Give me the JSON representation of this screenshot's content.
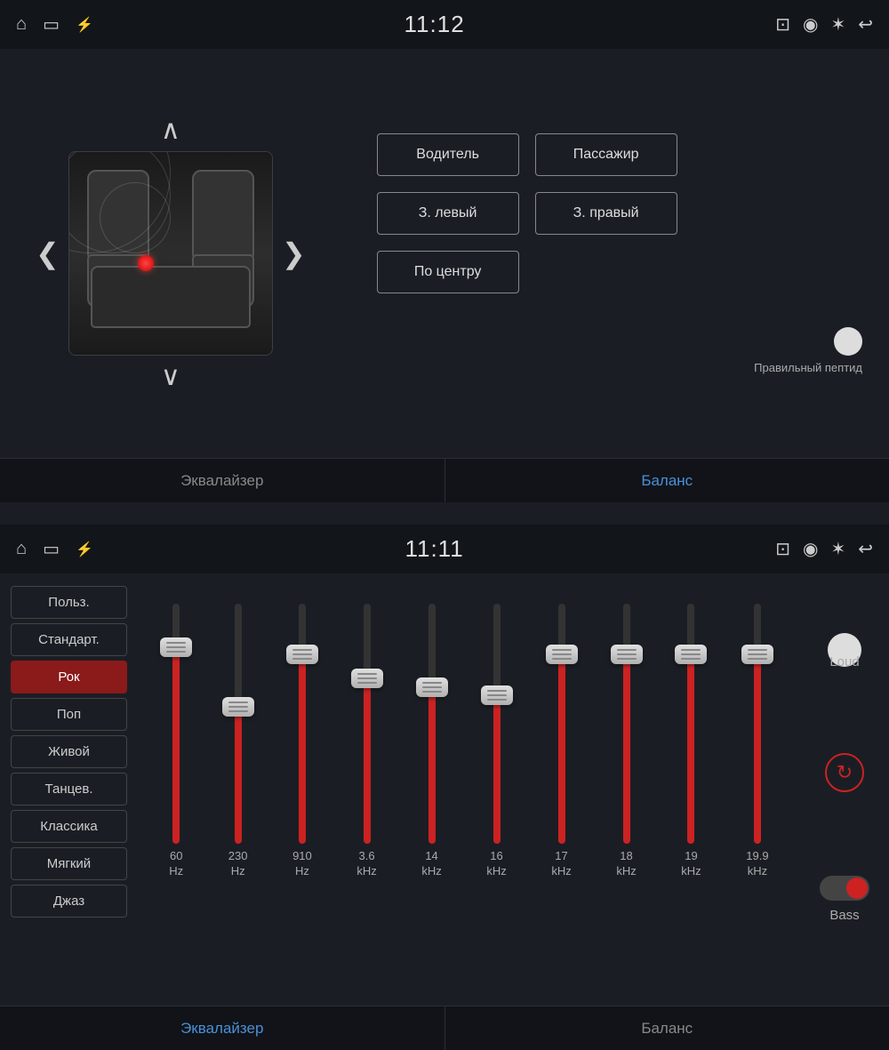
{
  "topPanel": {
    "statusBar": {
      "time": "11:12",
      "icons": {
        "home": "⌂",
        "screen": "▭",
        "usb": "⚡",
        "cast": "⊡",
        "location": "◉",
        "bluetooth": "✶",
        "back": "↩"
      }
    },
    "upArrow": "∧",
    "downArrow": "∨",
    "leftArrow": "❮",
    "rightArrow": "❯",
    "speakerButtons": {
      "driver": "Водитель",
      "passenger": "Пассажир",
      "rearLeft": "З. левый",
      "rearRight": "З. правый",
      "center": "По центру"
    },
    "toggleLabel": "Правильный пептид",
    "tabs": {
      "equalizer": "Эквалайзер",
      "balance": "Баланс"
    }
  },
  "bottomPanel": {
    "statusBar": {
      "time": "11:11"
    },
    "presets": [
      {
        "label": "Польз.",
        "active": false
      },
      {
        "label": "Стандарт.",
        "active": false
      },
      {
        "label": "Рок",
        "active": true
      },
      {
        "label": "Поп",
        "active": false
      },
      {
        "label": "Живой",
        "active": false
      },
      {
        "label": "Танцев.",
        "active": false
      },
      {
        "label": "Классика",
        "active": false
      },
      {
        "label": "Мягкий",
        "active": false
      },
      {
        "label": "Джаз",
        "active": false
      }
    ],
    "sliders": [
      {
        "freq": "60",
        "unit": "Hz",
        "heightPct": 85,
        "thumbPct": 82
      },
      {
        "freq": "230",
        "unit": "Hz",
        "heightPct": 60,
        "thumbPct": 57
      },
      {
        "freq": "910",
        "unit": "Hz",
        "heightPct": 82,
        "thumbPct": 79
      },
      {
        "freq": "3.6",
        "unit": "kHz",
        "heightPct": 72,
        "thumbPct": 69
      },
      {
        "freq": "14",
        "unit": "kHz",
        "heightPct": 68,
        "thumbPct": 65
      },
      {
        "freq": "16",
        "unit": "kHz",
        "heightPct": 65,
        "thumbPct": 62
      },
      {
        "freq": "17",
        "unit": "kHz",
        "heightPct": 82,
        "thumbPct": 79
      },
      {
        "freq": "18",
        "unit": "kHz",
        "heightPct": 82,
        "thumbPct": 79
      },
      {
        "freq": "19",
        "unit": "kHz",
        "heightPct": 82,
        "thumbPct": 79
      },
      {
        "freq": "19.9",
        "unit": "kHz",
        "heightPct": 82,
        "thumbPct": 79
      }
    ],
    "rightControls": {
      "loudLabel": "Loud",
      "resetIcon": "↻",
      "bassLabel": "Bass"
    },
    "tabs": {
      "equalizer": "Эквалайзер",
      "balance": "Баланс"
    }
  }
}
